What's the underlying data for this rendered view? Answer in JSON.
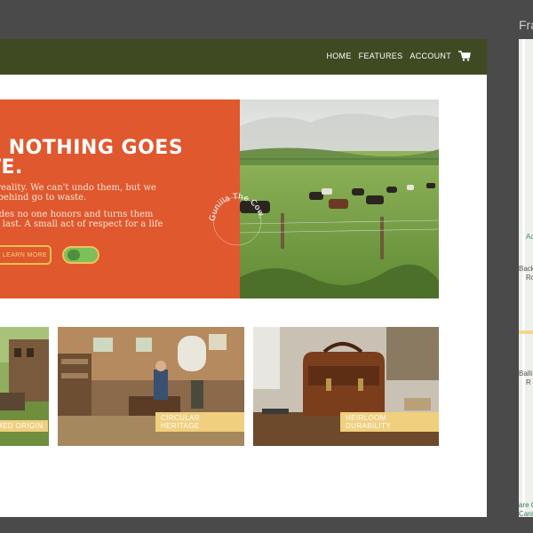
{
  "nav": {
    "links": [
      "HOME",
      "FEATURES",
      "ACCOUNT"
    ],
    "cart_icon": "cart-icon"
  },
  "hero": {
    "title_lines": [
      "E NOTHING GOES",
      "TE."
    ],
    "paragraph1_lines": [
      "tal reality. We can't undo them, but we",
      "we behind go to waste."
    ],
    "paragraph2_lines": [
      "e hides no one honors and turns them",
      "d to last. A small act of respect for a life"
    ],
    "learn_more": "LEARN MORE",
    "stamp_text": "Gunilla The Cow.",
    "toggle_on": true
  },
  "cards": [
    {
      "label": "MED ORIGIN"
    },
    {
      "label": "CIRCULAR HERITAGE"
    },
    {
      "label": "HEIRLOOM DURABILITY"
    }
  ],
  "side_panel": {
    "title": "Fra",
    "map_labels": [
      "Ac",
      "Back",
      "Ro",
      "Balli",
      "R",
      "are C",
      "Carav"
    ]
  },
  "colors": {
    "nav_bg": "#3f4a22",
    "hero_orange": "#e0582e",
    "accent_yellow": "#f0cf7e",
    "toggle_green": "#7cbf5c",
    "outer_bg": "#4a4a4a"
  }
}
